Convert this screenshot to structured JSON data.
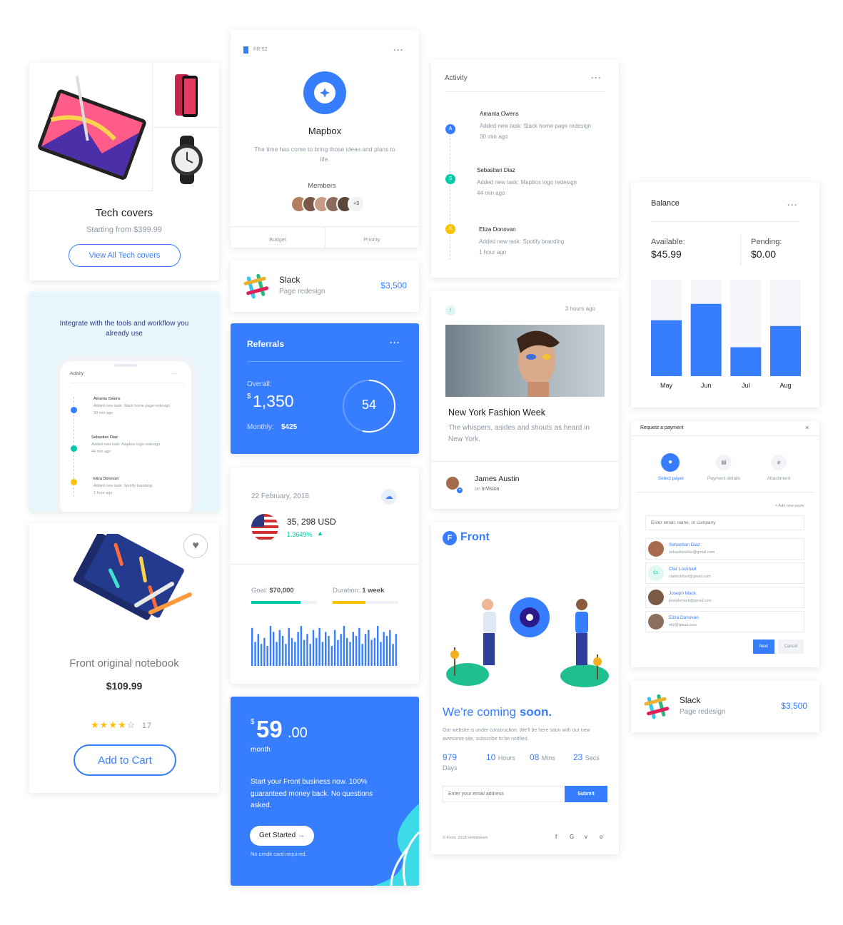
{
  "colors": {
    "primary": "#377dff",
    "teal": "#00c9a7",
    "yellow": "#ffc107",
    "text": "#1e2022",
    "muted": "#8c98a4"
  },
  "tech": {
    "title": "Tech covers",
    "subtitle": "Starting from $399.99",
    "button": "View All Tech covers"
  },
  "integrate": {
    "heading": "Integrate with the tools and workflow you already use",
    "phone_title": "Activity",
    "items": [
      {
        "name": "Amanta Owens",
        "text": "Added new task: Slack home page redesign",
        "time": "30 min ago"
      },
      {
        "name": "Sebastian Diaz",
        "text": "Added new task: Mapbox logo redesign",
        "time": "44 min ago"
      },
      {
        "name": "Eliza Donovan",
        "text": "Added new task: Spotify branding",
        "time": "1 hour ago"
      }
    ]
  },
  "notebook": {
    "title": "Front original notebook",
    "price": "$109.99",
    "rating": 4,
    "reviews": "17",
    "button": "Add to Cart"
  },
  "mapbox": {
    "tag": "FR-52",
    "title": "Mapbox",
    "desc": "The time has come to bring those ideas and plans to life.",
    "members_label": "Members",
    "members_more": "+3",
    "footer": [
      "Budget",
      "Priority"
    ]
  },
  "slack1": {
    "title": "Slack",
    "sub": "Page redesign",
    "amount": "$3,500"
  },
  "referrals": {
    "title": "Referrals",
    "overall_label": "Overall:",
    "currency": "$",
    "overall": "1,350",
    "monthly_label": "Monthly:",
    "monthly": "$425",
    "circle": "54"
  },
  "finance": {
    "date": "22 February, 2018",
    "amount": "35, 298 USD",
    "change": "1.3649%",
    "goal_label": "Goal:",
    "goal": "$70,000",
    "duration_label": "Duration:",
    "duration": "1 week",
    "goal_progress": 0.75,
    "duration_progress": 0.5,
    "bars": [
      0.95,
      0.6,
      0.8,
      0.55,
      0.7,
      0.5,
      1.0,
      0.85,
      0.6,
      0.9,
      0.75,
      0.55,
      0.95,
      0.7,
      0.6,
      0.85,
      1.0,
      0.65,
      0.8,
      0.55,
      0.9,
      0.7,
      0.95,
      0.6,
      0.85,
      0.75,
      0.5,
      0.9,
      0.65,
      0.8,
      1.0,
      0.7,
      0.6,
      0.85,
      0.75,
      0.95,
      0.55,
      0.8,
      0.9,
      0.65,
      0.7,
      1.0,
      0.6,
      0.85,
      0.75,
      0.9,
      0.55,
      0.8
    ]
  },
  "pricing": {
    "currency": "$",
    "price": "59",
    "cents": ".00",
    "period": "month",
    "desc": "Start your Front business now. 100% guaranteed money back. No questions asked.",
    "button": "Get Started",
    "note": "No credit card required."
  },
  "activity": {
    "title": "Activity",
    "items": [
      {
        "initial": "A",
        "name": "Amanta Owens",
        "text": "Added new task: Slack home page redesign",
        "time": "30 min ago"
      },
      {
        "initial": "S",
        "name": "Sebastian Diaz",
        "text": "Added new task: Mapbox logo redesign",
        "time": "44 min ago"
      },
      {
        "initial": "E",
        "name": "Eliza Donovan",
        "text": "Added new task: Spotify branding",
        "time": "1 hour ago"
      }
    ]
  },
  "fashion": {
    "time": "3 hours ago",
    "title": "New York Fashion Week",
    "desc": "The whispers, asides and shouts as heard in New York.",
    "author": "James Austin",
    "on": "on",
    "platform": "InVision"
  },
  "coming": {
    "brand": "Front",
    "title_a": "We're coming ",
    "title_b": "soon.",
    "desc": "Our website is under construction. We'll be here soon with our new awesome site, subscribe to be notified.",
    "countdown": [
      {
        "v": "979",
        "u": "Days"
      },
      {
        "v": "10",
        "u": "Hours"
      },
      {
        "v": "08",
        "u": "Mins"
      },
      {
        "v": "23",
        "u": "Secs"
      }
    ],
    "placeholder": "Enter your email address",
    "button": "Submit",
    "footer": "© Front. 2018 Htmlstream",
    "social": [
      "f",
      "G",
      "v",
      "o"
    ]
  },
  "balance": {
    "title": "Balance",
    "available_label": "Available:",
    "available": "$45.99",
    "pending_label": "Pending:",
    "pending": "$0.00",
    "chart_data": {
      "type": "bar",
      "categories": [
        "May",
        "Jun",
        "Jul",
        "Aug"
      ],
      "values": [
        58,
        75,
        30,
        52
      ],
      "ylim": [
        0,
        100
      ]
    }
  },
  "payment": {
    "title": "Request a payment",
    "steps": [
      "Select payer",
      "Payment details",
      "Attachment"
    ],
    "add": "+ Add new payer",
    "placeholder": "Enter email, name, or company",
    "payers": [
      {
        "name": "Sebastian Diaz",
        "email": "sebastiandiaz@gmail.com",
        "initials": ""
      },
      {
        "name": "Clar Lockhart",
        "email": "clarlockhart@gmail.com",
        "initials": "CL"
      },
      {
        "name": "Joseph Mack",
        "email": "josephmack@gmail.com",
        "initials": ""
      },
      {
        "name": "Eliza Donovan",
        "email": "eliz@gmail.com",
        "initials": ""
      }
    ],
    "next": "Next",
    "cancel": "Cancel"
  },
  "slack2": {
    "title": "Slack",
    "sub": "Page redesign",
    "amount": "$3,500"
  }
}
